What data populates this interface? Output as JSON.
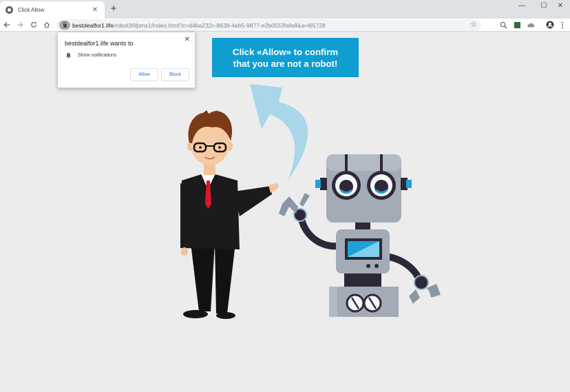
{
  "browser": {
    "tab_title": "Click Allow",
    "new_tab_symbol": "+",
    "url_host": "bestdealfor1.life",
    "url_path": "/robot36fpms1/index.html?c=d4ba232c-8638-4eb5-9877-e2b0553fafe8&a=l65728",
    "window_controls": {
      "minimize": "—",
      "maximize": "☐",
      "close": "✕"
    },
    "icons": [
      "back-arrow-icon",
      "forward-arrow-icon",
      "reload-icon",
      "home-icon",
      "lock-icon",
      "star-icon",
      "zoom-icon",
      "extension-icon",
      "account-icon",
      "menu-icon"
    ]
  },
  "permission_popup": {
    "title": "bestdealfor1.life wants to",
    "item": "Show notifications",
    "allow_label": "Allow",
    "block_label": "Block",
    "close_symbol": "✕"
  },
  "banner": {
    "line1": "Click «Allow» to confirm",
    "line2": "that you are not a robot!",
    "color": "#0e9ed1"
  },
  "colors": {
    "page_background": "#ececec",
    "accent": "#1a73e8",
    "arrow": "#a9d6e8"
  }
}
